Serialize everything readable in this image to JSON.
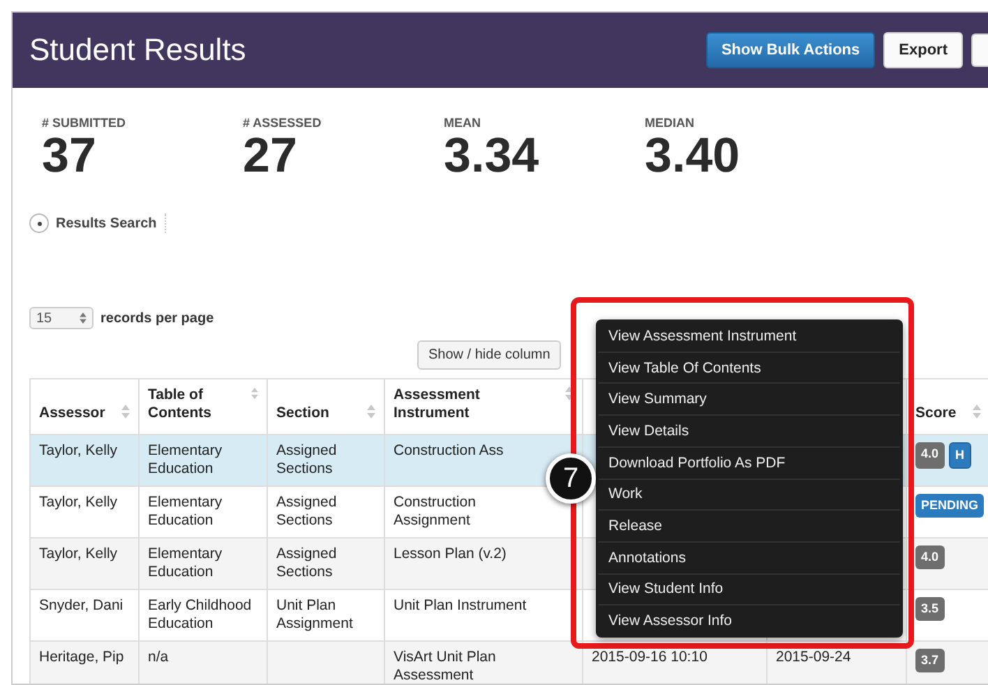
{
  "header": {
    "title": "Student Results",
    "buttons": [
      {
        "label": "Show Bulk Actions",
        "kind": "primary"
      },
      {
        "label": "Export",
        "kind": "default"
      },
      {
        "kind": "cutoff"
      }
    ]
  },
  "stats": [
    {
      "label": "# SUBMITTED",
      "value": "37"
    },
    {
      "label": "# ASSESSED",
      "value": "27"
    },
    {
      "label": "MEAN",
      "value": "3.34"
    },
    {
      "label": "MEDIAN",
      "value": "3.40"
    }
  ],
  "results_search": {
    "label": "Results Search",
    "expanded": false
  },
  "records_per_page": {
    "value": "15",
    "label": "records per page"
  },
  "column_toggle": {
    "label": "Show / hide column"
  },
  "table": {
    "columns": [
      {
        "label": "Assessor"
      },
      {
        "label": "Table of Contents"
      },
      {
        "label": "Section"
      },
      {
        "label": "Assessment Instrument"
      },
      {
        "covered": true
      },
      {
        "covered": true
      },
      {
        "label": "Score"
      }
    ],
    "rows": [
      {
        "selected": true,
        "cells": [
          "Taylor, Kelly",
          "Elementary Education",
          "Assigned Sections",
          "Construction Ass"
        ],
        "badges": [
          {
            "text": "4.0",
            "kind": "score"
          },
          {
            "text": "H",
            "kind": "flag"
          }
        ]
      },
      {
        "selected": false,
        "cells": [
          "Taylor, Kelly",
          "Elementary Education",
          "Assigned Sections",
          "Construction Assignment"
        ],
        "badges": [
          {
            "text": "PENDING",
            "kind": "status"
          }
        ]
      },
      {
        "selected": false,
        "cells": [
          "Taylor, Kelly",
          "Elementary Education",
          "Assigned Sections",
          "Lesson Plan (v.2)"
        ],
        "badges": [
          {
            "text": "4.0",
            "kind": "score"
          }
        ]
      },
      {
        "selected": false,
        "cells": [
          "Snyder, Dani",
          "Early Childhood Education",
          "Unit Plan Assignment",
          "Unit Plan Instrument"
        ],
        "badges": [
          {
            "text": "3.5",
            "kind": "score"
          }
        ]
      },
      {
        "selected": false,
        "cells": [
          "Heritage, Pip",
          "n/a",
          null,
          "VisArt Unit Plan Assessment",
          "2015-09-16 10:10",
          "2015-09-24"
        ],
        "badges": [
          {
            "text": "3.7",
            "kind": "score"
          }
        ]
      }
    ]
  },
  "context_menu": {
    "items": [
      "View Assessment Instrument",
      "View Table Of Contents",
      "View Summary",
      "View Details",
      "Download Portfolio As PDF",
      "Work",
      "Release",
      "Annotations",
      "View Student Info",
      "View Assessor Info"
    ]
  },
  "callout": {
    "number": "7"
  }
}
